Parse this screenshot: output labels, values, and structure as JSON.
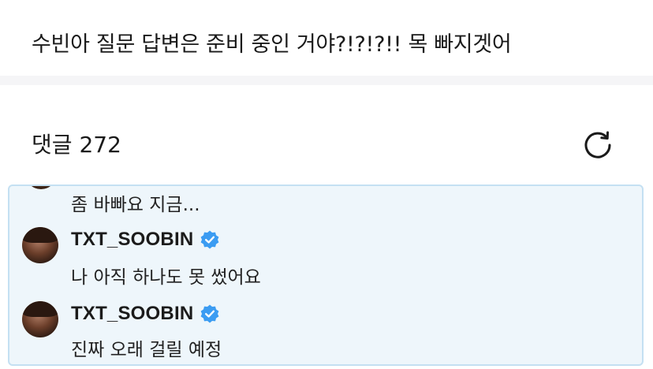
{
  "post": {
    "text": "수빈아 질문 답변은 준비 중인 거야?!?!?!! 목 빠지겟어"
  },
  "comments": {
    "header_label": "댓글",
    "count": "272",
    "refresh_icon": "refresh-icon"
  },
  "thread": {
    "first_reply_text": "좀 바빠요 지금...",
    "replies": [
      {
        "author": "TXT_SOOBIN",
        "verified": true,
        "text": "나 아직 하나도 못 썼어요"
      },
      {
        "author": "TXT_SOOBIN",
        "verified": true,
        "text": "진짜 오래 걸릴 예정"
      }
    ]
  },
  "colors": {
    "thread_background": "#eef6fb",
    "thread_border": "#c4e0f2",
    "verified_badge": "#3b9cf2"
  }
}
